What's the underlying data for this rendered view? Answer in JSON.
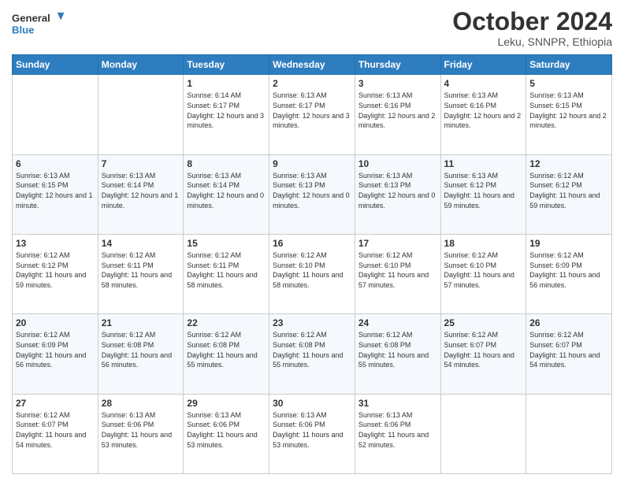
{
  "logo": {
    "line1": "General",
    "line2": "Blue"
  },
  "title": "October 2024",
  "subtitle": "Leku, SNNPR, Ethiopia",
  "weekdays": [
    "Sunday",
    "Monday",
    "Tuesday",
    "Wednesday",
    "Thursday",
    "Friday",
    "Saturday"
  ],
  "weeks": [
    [
      {
        "day": "",
        "info": ""
      },
      {
        "day": "",
        "info": ""
      },
      {
        "day": "1",
        "info": "Sunrise: 6:14 AM\nSunset: 6:17 PM\nDaylight: 12 hours and 3 minutes."
      },
      {
        "day": "2",
        "info": "Sunrise: 6:13 AM\nSunset: 6:17 PM\nDaylight: 12 hours and 3 minutes."
      },
      {
        "day": "3",
        "info": "Sunrise: 6:13 AM\nSunset: 6:16 PM\nDaylight: 12 hours and 2 minutes."
      },
      {
        "day": "4",
        "info": "Sunrise: 6:13 AM\nSunset: 6:16 PM\nDaylight: 12 hours and 2 minutes."
      },
      {
        "day": "5",
        "info": "Sunrise: 6:13 AM\nSunset: 6:15 PM\nDaylight: 12 hours and 2 minutes."
      }
    ],
    [
      {
        "day": "6",
        "info": "Sunrise: 6:13 AM\nSunset: 6:15 PM\nDaylight: 12 hours and 1 minute."
      },
      {
        "day": "7",
        "info": "Sunrise: 6:13 AM\nSunset: 6:14 PM\nDaylight: 12 hours and 1 minute."
      },
      {
        "day": "8",
        "info": "Sunrise: 6:13 AM\nSunset: 6:14 PM\nDaylight: 12 hours and 0 minutes."
      },
      {
        "day": "9",
        "info": "Sunrise: 6:13 AM\nSunset: 6:13 PM\nDaylight: 12 hours and 0 minutes."
      },
      {
        "day": "10",
        "info": "Sunrise: 6:13 AM\nSunset: 6:13 PM\nDaylight: 12 hours and 0 minutes."
      },
      {
        "day": "11",
        "info": "Sunrise: 6:13 AM\nSunset: 6:12 PM\nDaylight: 11 hours and 59 minutes."
      },
      {
        "day": "12",
        "info": "Sunrise: 6:12 AM\nSunset: 6:12 PM\nDaylight: 11 hours and 59 minutes."
      }
    ],
    [
      {
        "day": "13",
        "info": "Sunrise: 6:12 AM\nSunset: 6:12 PM\nDaylight: 11 hours and 59 minutes."
      },
      {
        "day": "14",
        "info": "Sunrise: 6:12 AM\nSunset: 6:11 PM\nDaylight: 11 hours and 58 minutes."
      },
      {
        "day": "15",
        "info": "Sunrise: 6:12 AM\nSunset: 6:11 PM\nDaylight: 11 hours and 58 minutes."
      },
      {
        "day": "16",
        "info": "Sunrise: 6:12 AM\nSunset: 6:10 PM\nDaylight: 11 hours and 58 minutes."
      },
      {
        "day": "17",
        "info": "Sunrise: 6:12 AM\nSunset: 6:10 PM\nDaylight: 11 hours and 57 minutes."
      },
      {
        "day": "18",
        "info": "Sunrise: 6:12 AM\nSunset: 6:10 PM\nDaylight: 11 hours and 57 minutes."
      },
      {
        "day": "19",
        "info": "Sunrise: 6:12 AM\nSunset: 6:09 PM\nDaylight: 11 hours and 56 minutes."
      }
    ],
    [
      {
        "day": "20",
        "info": "Sunrise: 6:12 AM\nSunset: 6:09 PM\nDaylight: 11 hours and 56 minutes."
      },
      {
        "day": "21",
        "info": "Sunrise: 6:12 AM\nSunset: 6:08 PM\nDaylight: 11 hours and 56 minutes."
      },
      {
        "day": "22",
        "info": "Sunrise: 6:12 AM\nSunset: 6:08 PM\nDaylight: 11 hours and 55 minutes."
      },
      {
        "day": "23",
        "info": "Sunrise: 6:12 AM\nSunset: 6:08 PM\nDaylight: 11 hours and 55 minutes."
      },
      {
        "day": "24",
        "info": "Sunrise: 6:12 AM\nSunset: 6:08 PM\nDaylight: 11 hours and 55 minutes."
      },
      {
        "day": "25",
        "info": "Sunrise: 6:12 AM\nSunset: 6:07 PM\nDaylight: 11 hours and 54 minutes."
      },
      {
        "day": "26",
        "info": "Sunrise: 6:12 AM\nSunset: 6:07 PM\nDaylight: 11 hours and 54 minutes."
      }
    ],
    [
      {
        "day": "27",
        "info": "Sunrise: 6:12 AM\nSunset: 6:07 PM\nDaylight: 11 hours and 54 minutes."
      },
      {
        "day": "28",
        "info": "Sunrise: 6:13 AM\nSunset: 6:06 PM\nDaylight: 11 hours and 53 minutes."
      },
      {
        "day": "29",
        "info": "Sunrise: 6:13 AM\nSunset: 6:06 PM\nDaylight: 11 hours and 53 minutes."
      },
      {
        "day": "30",
        "info": "Sunrise: 6:13 AM\nSunset: 6:06 PM\nDaylight: 11 hours and 53 minutes."
      },
      {
        "day": "31",
        "info": "Sunrise: 6:13 AM\nSunset: 6:06 PM\nDaylight: 11 hours and 52 minutes."
      },
      {
        "day": "",
        "info": ""
      },
      {
        "day": "",
        "info": ""
      }
    ]
  ]
}
